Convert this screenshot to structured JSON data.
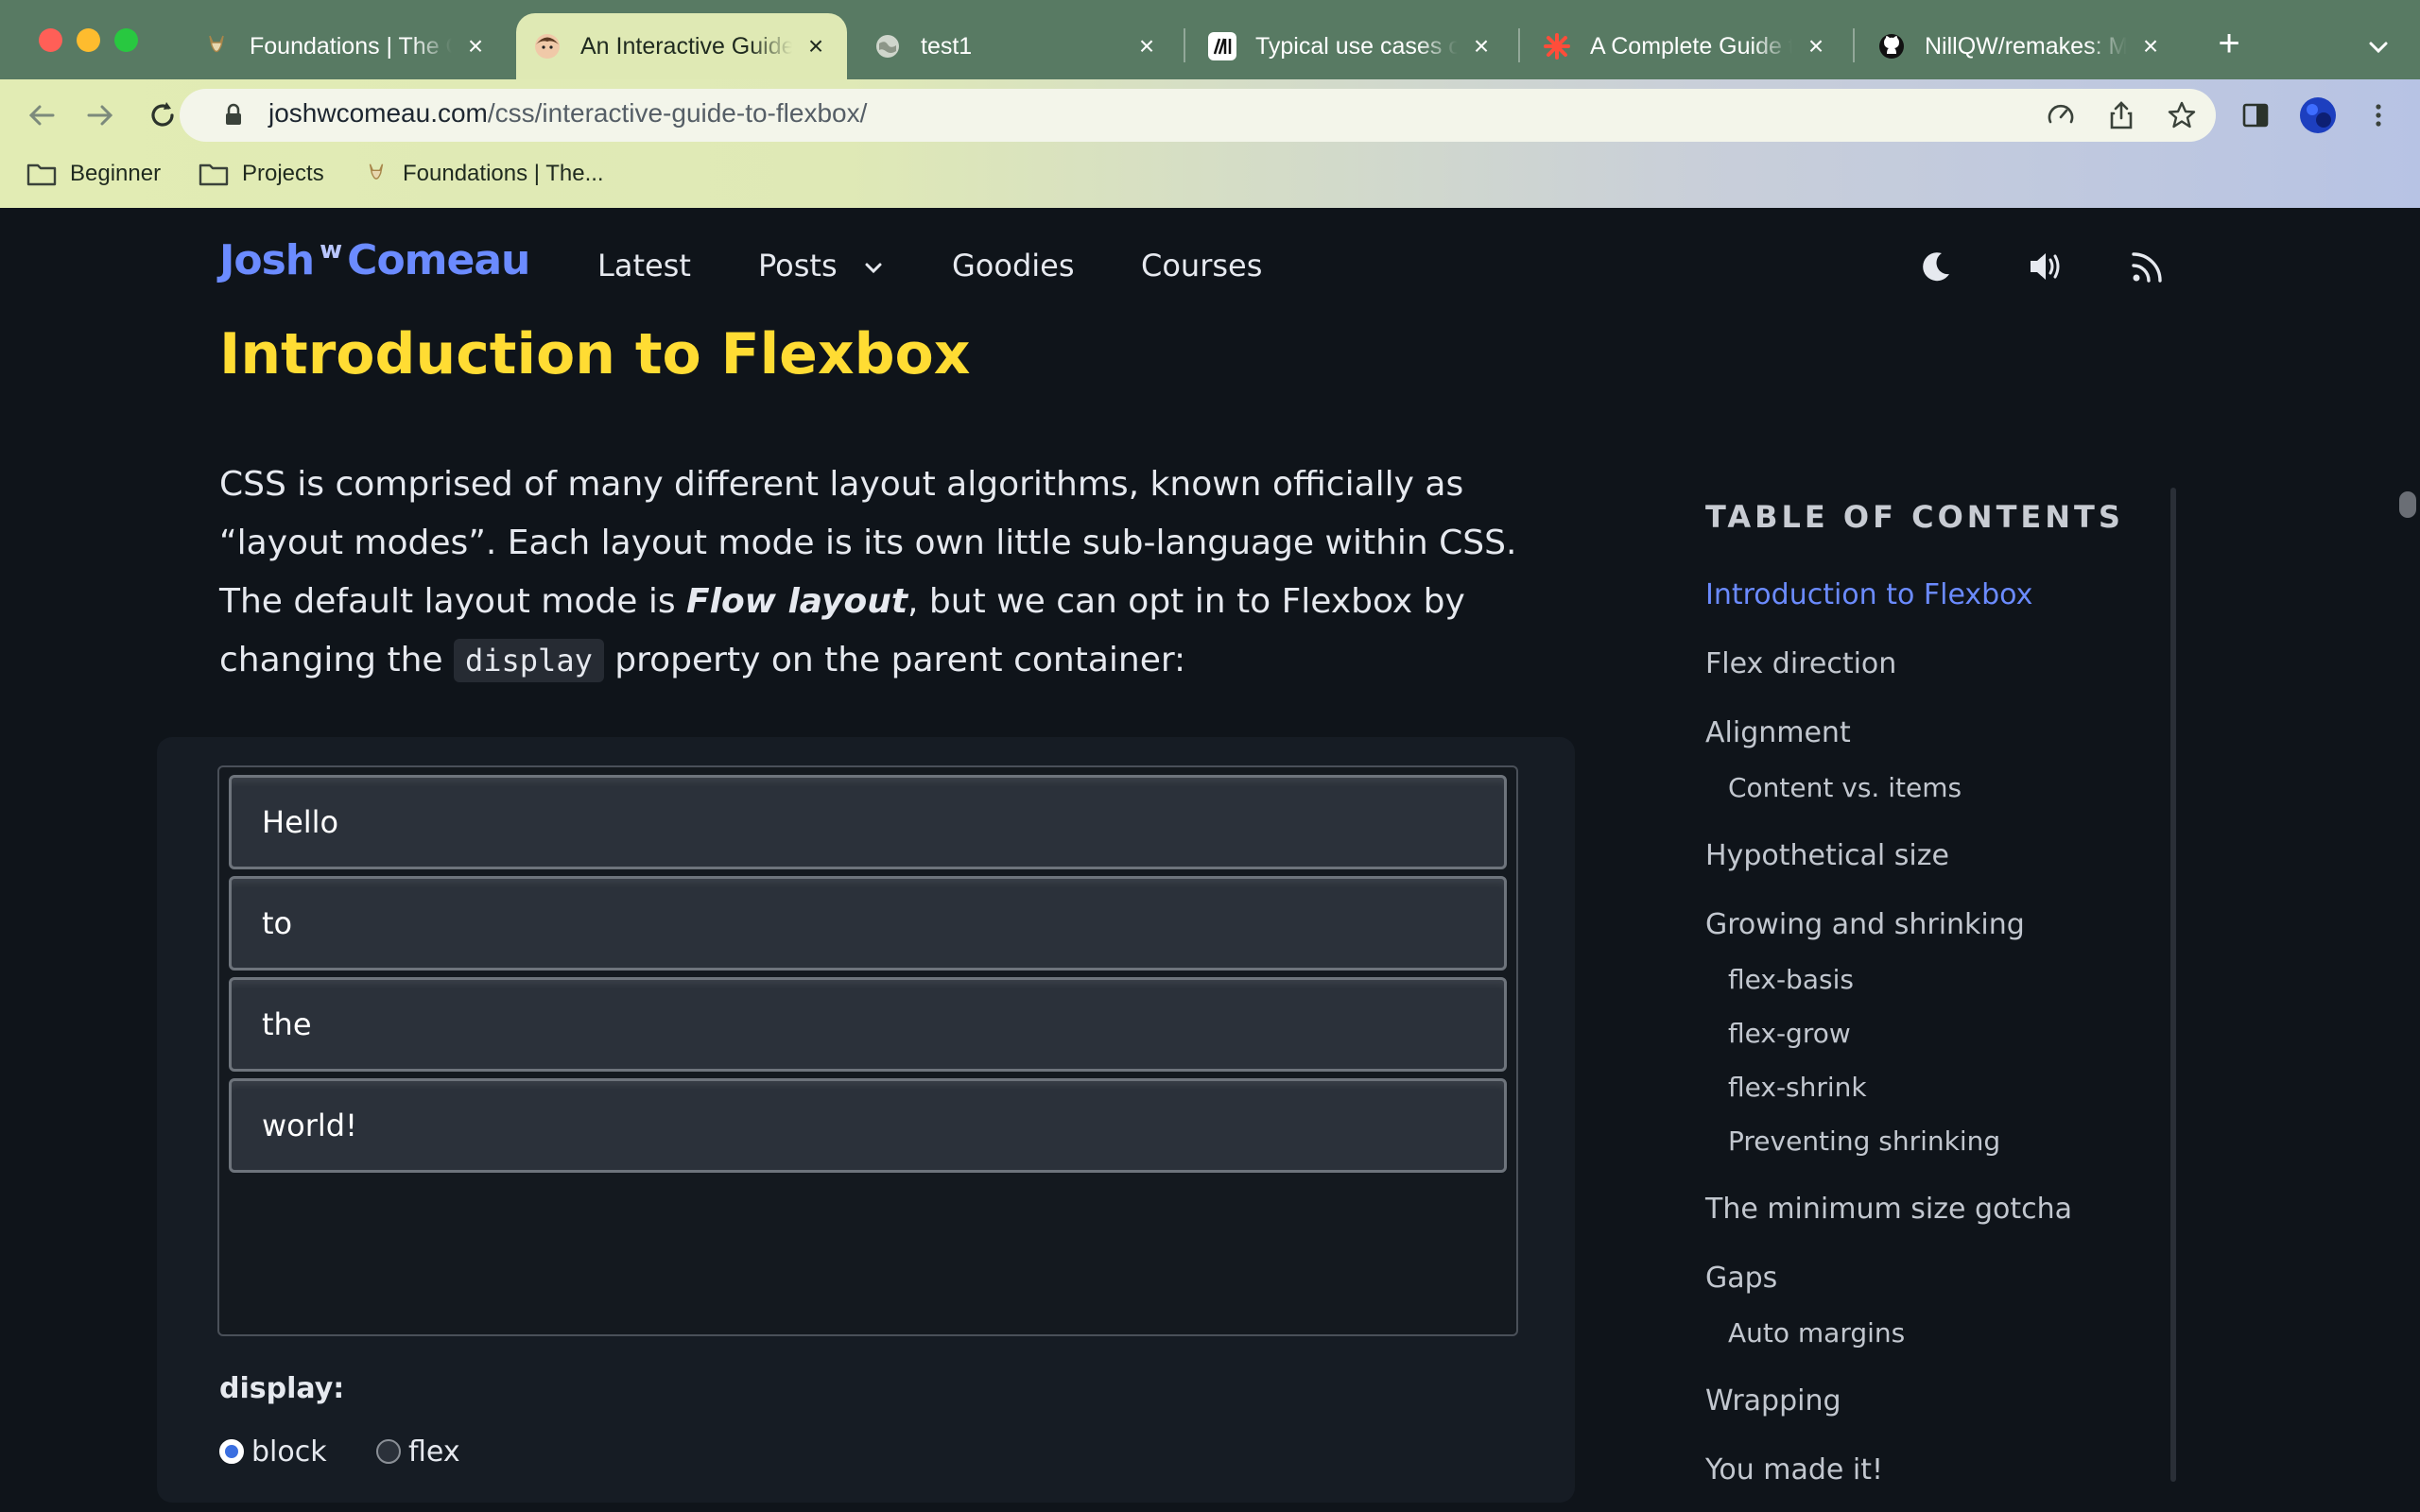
{
  "browser": {
    "tabs": [
      {
        "title": "Foundations | The Odin Project",
        "favicon": "odin-icon",
        "active": false
      },
      {
        "title": "An Interactive Guide to Flexbox",
        "favicon": "josh-avatar-icon",
        "active": true
      },
      {
        "title": "test1",
        "favicon": "globe-icon",
        "active": false
      },
      {
        "title": "Typical use cases of Flexbox",
        "favicon": "mdn-icon",
        "active": false
      },
      {
        "title": "A Complete Guide to Flexbox",
        "favicon": "css-tricks-icon",
        "active": false
      },
      {
        "title": "NillQW/remakes: My",
        "favicon": "github-icon",
        "active": false
      }
    ],
    "address": {
      "domain": "joshwcomeau.com",
      "path": "/css/interactive-guide-to-flexbox/"
    },
    "bookmarks": [
      {
        "label": "Beginner",
        "icon": "folder-icon"
      },
      {
        "label": "Projects",
        "icon": "folder-icon"
      },
      {
        "label": "Foundations | The...",
        "icon": "odin-icon"
      }
    ]
  },
  "site": {
    "logo_first": "Josh",
    "logo_mark": "w",
    "logo_second": "Comeau",
    "nav": {
      "latest": "Latest",
      "posts": "Posts",
      "goodies": "Goodies",
      "courses": "Courses"
    }
  },
  "article": {
    "title": "Introduction to Flexbox",
    "intro_1": "CSS is comprised of many different layout algorithms, known officially as “layout modes”. Each layout mode is its own little sub-language within CSS. The default layout mode is ",
    "intro_em": "Flow layout",
    "intro_2": ", but we can opt in to Flexbox by changing the ",
    "intro_code": "display",
    "intro_3": " property on the parent container:"
  },
  "demo": {
    "items": [
      "Hello",
      "to",
      "the",
      "world!"
    ],
    "control_label": "display:",
    "options": [
      {
        "label": "block",
        "checked": true
      },
      {
        "label": "flex",
        "checked": false
      }
    ]
  },
  "toc": {
    "heading": "TABLE OF CONTENTS",
    "items": [
      {
        "label": "Introduction to Flexbox",
        "level": 1,
        "active": true
      },
      {
        "label": "Flex direction",
        "level": 1,
        "active": false
      },
      {
        "label": "Alignment",
        "level": 1,
        "active": false
      },
      {
        "label": "Content vs. items",
        "level": 2,
        "active": false
      },
      {
        "label": "Hypothetical size",
        "level": 1,
        "active": false
      },
      {
        "label": "Growing and shrinking",
        "level": 1,
        "active": false
      },
      {
        "label": "flex-basis",
        "level": 2,
        "active": false
      },
      {
        "label": "flex-grow",
        "level": 2,
        "active": false
      },
      {
        "label": "flex-shrink",
        "level": 2,
        "active": false
      },
      {
        "label": "Preventing shrinking",
        "level": 2,
        "active": false
      },
      {
        "label": "The minimum size gotcha",
        "level": 1,
        "active": false
      },
      {
        "label": "Gaps",
        "level": 1,
        "active": false
      },
      {
        "label": "Auto margins",
        "level": 2,
        "active": false
      },
      {
        "label": "Wrapping",
        "level": 1,
        "active": false
      },
      {
        "label": "You made it!",
        "level": 1,
        "active": false
      }
    ]
  },
  "colors": {
    "page_bg": "#0f141a",
    "title": "#ffdc33",
    "accent": "#6b8bff",
    "tabstrip": "#587a63"
  }
}
